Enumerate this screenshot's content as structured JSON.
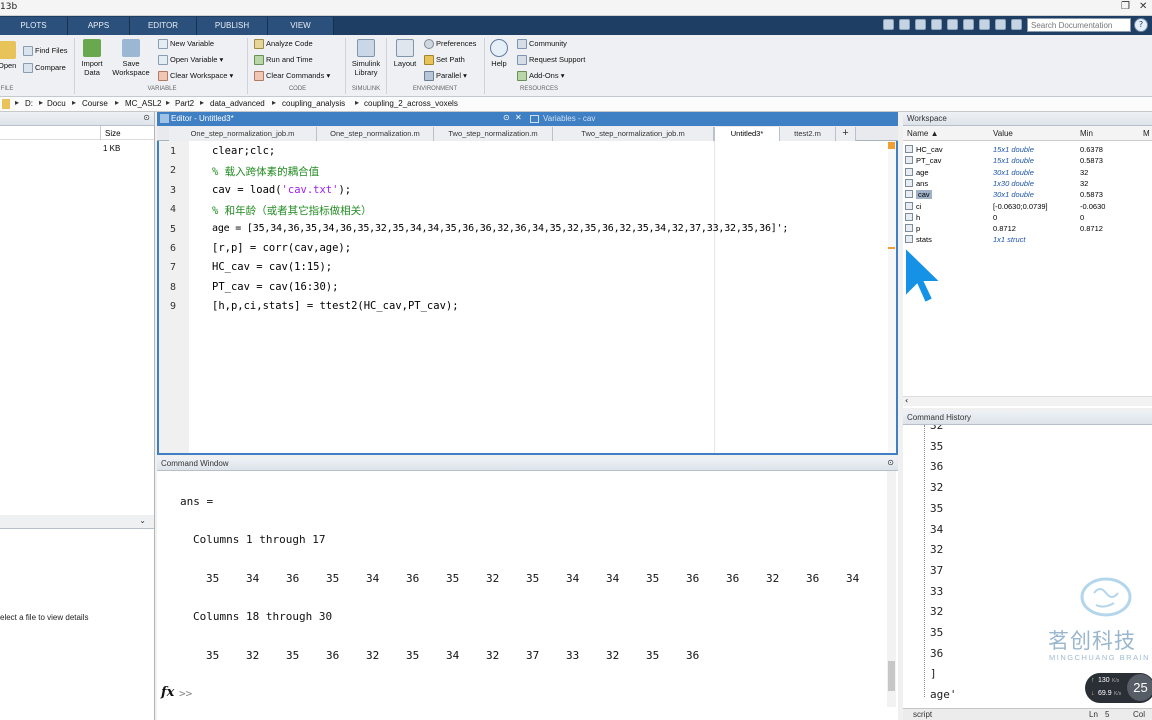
{
  "window": {
    "title_fragment": "13b",
    "restore_glyph": "❐",
    "close_glyph": "✕"
  },
  "toolstrip_tabs": [
    "PLOTS",
    "APPS",
    "EDITOR",
    "PUBLISH",
    "VIEW"
  ],
  "search": {
    "placeholder": "Search Documentation",
    "help_glyph": "?"
  },
  "ribbon": {
    "file": {
      "open": "Open",
      "find_files": "Find Files",
      "compare": "Compare",
      "group": "FILE"
    },
    "variable": {
      "import_data": "Import Data",
      "save_workspace": "Save Workspace",
      "new_variable": "New Variable",
      "open_variable": "Open Variable",
      "clear_workspace": "Clear Workspace",
      "group": "VARIABLE"
    },
    "code": {
      "analyze_code": "Analyze Code",
      "run_and_time": "Run and Time",
      "clear_commands": "Clear Commands",
      "group": "CODE"
    },
    "simulink": {
      "library": "Simulink Library",
      "group": "SIMULINK"
    },
    "environment": {
      "layout": "Layout",
      "preferences": "Preferences",
      "set_path": "Set Path",
      "parallel": "Parallel",
      "group": "ENVIRONMENT"
    },
    "resources": {
      "help": "Help",
      "community": "Community",
      "request_support": "Request Support",
      "add_ons": "Add-Ons",
      "group": "RESOURCES"
    }
  },
  "path": [
    "D:",
    "Docu",
    "Course",
    "MC_ASL2",
    "Part2",
    "data_advanced",
    "coupling_analysis",
    "coupling_2_across_voxels"
  ],
  "current_folder": {
    "size_header": "Size",
    "size_value": "1 KB",
    "details_text": "elect a file to view details"
  },
  "editor": {
    "title": "Editor - Untitled3*",
    "variables_title": "Variables - cav",
    "tabs": [
      "One_step_normalization_job.m",
      "One_step_normalization.m",
      "Two_step_normalization.m",
      "Two_step_normalization_job.m",
      "Untitled3*",
      "ttest2.m",
      "+"
    ],
    "lines": [
      {
        "n": "1",
        "code": "clear;clc;"
      },
      {
        "n": "2",
        "code": "% 载入跨体素的耦合值"
      },
      {
        "n": "3",
        "pre": "cav = load(",
        "str": "'cav.txt'",
        "post": ");"
      },
      {
        "n": "4",
        "code": "% 和年龄（或者其它指标做相关）"
      },
      {
        "n": "5",
        "code": "age = [35,34,36,35,34,36,35,32,35,34,34,35,36,36,32,36,34,35,32,35,36,32,35,34,32,37,33,32,35,36]';"
      },
      {
        "n": "6",
        "code": "[r,p] = corr(cav,age);"
      },
      {
        "n": "7",
        "code": "HC_cav = cav(1:15);"
      },
      {
        "n": "8",
        "code": "PT_cav = cav(16:30);"
      },
      {
        "n": "9",
        "code": "[h,p,ci,stats] = ttest2(HC_cav,PT_cav);"
      }
    ]
  },
  "command_window": {
    "title": "Command Window",
    "ans": "ans =",
    "cols1": "Columns 1 through 17",
    "row1": [
      "35",
      "34",
      "36",
      "35",
      "34",
      "36",
      "35",
      "32",
      "35",
      "34",
      "34",
      "35",
      "36",
      "36",
      "32",
      "36",
      "34"
    ],
    "cols2": "Columns 18 through 30",
    "row2": [
      "35",
      "32",
      "35",
      "36",
      "32",
      "35",
      "34",
      "32",
      "37",
      "33",
      "32",
      "35",
      "36"
    ],
    "prompt": ">>",
    "fx": "fx"
  },
  "workspace": {
    "title": "Workspace",
    "headers": [
      "Name ▲",
      "Value",
      "Min",
      "M"
    ],
    "rows": [
      {
        "name": "HC_cav",
        "value": "15x1 double",
        "min": "0.6378",
        "italic": true
      },
      {
        "name": "PT_cav",
        "value": "15x1 double",
        "min": "0.5873",
        "italic": true
      },
      {
        "name": "age",
        "value": "30x1 double",
        "min": "32",
        "italic": true
      },
      {
        "name": "ans",
        "value": "1x30 double",
        "min": "32",
        "italic": true
      },
      {
        "name": "cav",
        "value": "30x1 double",
        "min": "0.5873",
        "italic": true,
        "selected": true
      },
      {
        "name": "ci",
        "value": "[-0.0630;0.0739]",
        "min": "-0.0630",
        "italic": false
      },
      {
        "name": "h",
        "value": "0",
        "min": "0",
        "italic": false
      },
      {
        "name": "p",
        "value": "0.8712",
        "min": "0.8712",
        "italic": false
      },
      {
        "name": "stats",
        "value": "1x1 struct",
        "min": "",
        "italic": true
      }
    ]
  },
  "command_history": {
    "title": "Command History",
    "items": [
      "32",
      "35",
      "36",
      "32",
      "35",
      "34",
      "32",
      "37",
      "33",
      "32",
      "35",
      "36",
      "]",
      "age'"
    ]
  },
  "statusbar": {
    "script": "script",
    "ln": "Ln",
    "ln_val": "5",
    "col": "Col"
  },
  "watermark": {
    "line1": "茗创科技",
    "line2": "MINGCHUANG BRAIN"
  },
  "netspeed": {
    "up": "130",
    "up_unit": "K/s",
    "down": "69.9",
    "down_unit": "K/s",
    "badge": "25"
  },
  "colors": {
    "toolstrip": "#1f3e63",
    "editor_accent": "#3f7fc3",
    "comment": "#228b22",
    "string": "#a020f0"
  }
}
